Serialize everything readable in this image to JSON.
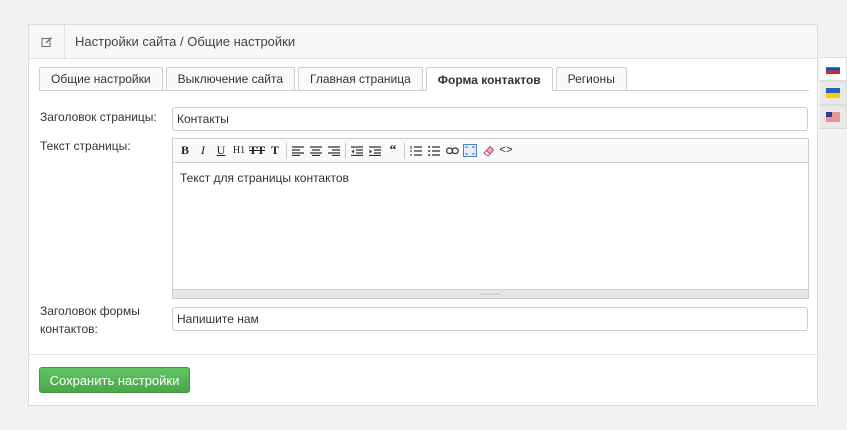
{
  "header": {
    "title": "Настройки сайта / Общие настройки",
    "icon": "edit-icon"
  },
  "tabs": [
    {
      "label": "Общие настройки",
      "active": false
    },
    {
      "label": "Выключение сайта",
      "active": false
    },
    {
      "label": "Главная страница",
      "active": false
    },
    {
      "label": "Форма контактов",
      "active": true
    },
    {
      "label": "Регионы",
      "active": false
    }
  ],
  "form": {
    "page_title_label": "Заголовок страницы:",
    "page_title_value": "Контакты",
    "page_text_label": "Текст страницы:",
    "page_text_value": "Текст для страницы контактов",
    "contact_form_title_label_line1": "Заголовок формы",
    "contact_form_title_label_line2": "контактов:",
    "contact_form_title_value": "Напишите нам"
  },
  "toolbar": {
    "bold": "B",
    "italic": "I",
    "underline": "U",
    "heading": "H1",
    "clear_format": "TT",
    "text_format": "T",
    "quote": "“",
    "code": "<>"
  },
  "save_button": "Сохранить настройки",
  "languages": [
    {
      "code": "ru",
      "active": true
    },
    {
      "code": "ua",
      "active": false
    },
    {
      "code": "us",
      "active": false
    }
  ],
  "colors": {
    "accent_green": "#5cb85c",
    "panel_bg": "#ffffff"
  }
}
